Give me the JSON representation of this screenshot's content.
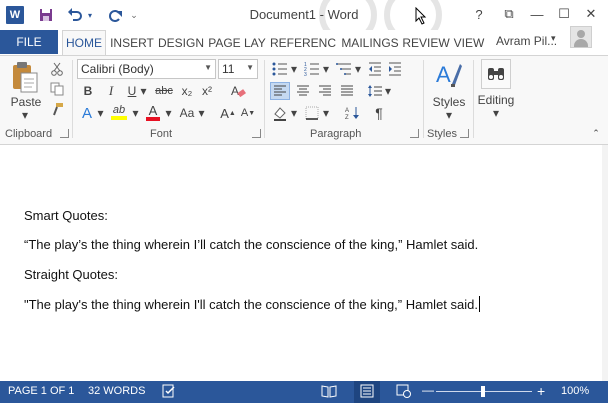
{
  "window": {
    "title": "Document1 - Word",
    "app_icon": "W",
    "controls": {
      "help": "?",
      "ribbon_display": "⧉",
      "minimize": "—",
      "maximize": "☐",
      "close": "✕"
    }
  },
  "quick_access": {
    "save_icon": "save-icon",
    "undo_icon": "undo-icon",
    "redo_icon": "redo-icon",
    "customize_icon": "customize-icon"
  },
  "tabs": [
    "FILE",
    "HOME",
    "INSERT",
    "DESIGN",
    "PAGE LAY",
    "REFERENC",
    "MAILINGS",
    "REVIEW",
    "VIEW"
  ],
  "user": {
    "name": "Avram Pil..."
  },
  "ribbon": {
    "clipboard": {
      "paste_label": "Paste",
      "group_label": "Clipboard"
    },
    "font": {
      "font_name": "Calibri (Body)",
      "font_size": "11",
      "group_label": "Font",
      "bold": "B",
      "italic": "I",
      "underline": "U",
      "strikethrough": "abc",
      "subscript": "x₂",
      "superscript": "x²",
      "text_effects": "A",
      "highlight": "ab",
      "font_color": "A",
      "change_case": "Aa",
      "grow": "A",
      "shrink": "A"
    },
    "paragraph": {
      "group_label": "Paragraph",
      "show_marks": "¶"
    },
    "styles": {
      "label": "Styles",
      "group_label": "Styles"
    },
    "editing": {
      "label": "Editing"
    }
  },
  "document": {
    "lines": [
      "Smart Quotes:",
      "“The play’s the thing wherein I’ll catch the conscience of the king,” Hamlet said.",
      "Straight Quotes:",
      "\"The play's the thing wherein I'll catch the conscience of the king,” Hamlet said."
    ]
  },
  "status": {
    "page": "PAGE 1 OF 1",
    "words": "32 WORDS",
    "zoom": "100%",
    "zoom_minus": "—",
    "zoom_plus": "+"
  },
  "colors": {
    "accent": "#2b579a",
    "highlight": "#ffff00",
    "font_color": "#e81123"
  }
}
